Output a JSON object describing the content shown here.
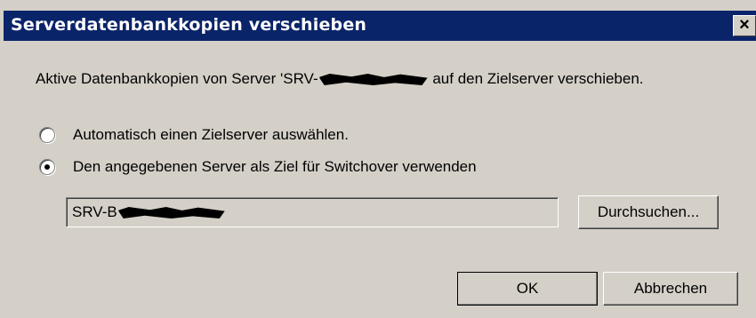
{
  "window": {
    "title": "Serverdatenbankkopien verschieben",
    "close_glyph": "×"
  },
  "description": {
    "prefix": "Aktive Datenbankkopien von Server 'SRV-",
    "suffix": "auf den Zielserver verschieben."
  },
  "options": {
    "auto": {
      "label": "Automatisch einen Zielserver auswählen.",
      "checked": false
    },
    "specified": {
      "label": "Den angegebenen Server als Ziel für Switchover verwenden",
      "checked": true
    }
  },
  "server_field": {
    "value_prefix": "SRV-B"
  },
  "buttons": {
    "browse": "Durchsuchen...",
    "ok": "OK",
    "cancel": "Abbrechen"
  },
  "colors": {
    "titlebar": "#0a246a",
    "dialog_bg": "#d4d0c8"
  }
}
